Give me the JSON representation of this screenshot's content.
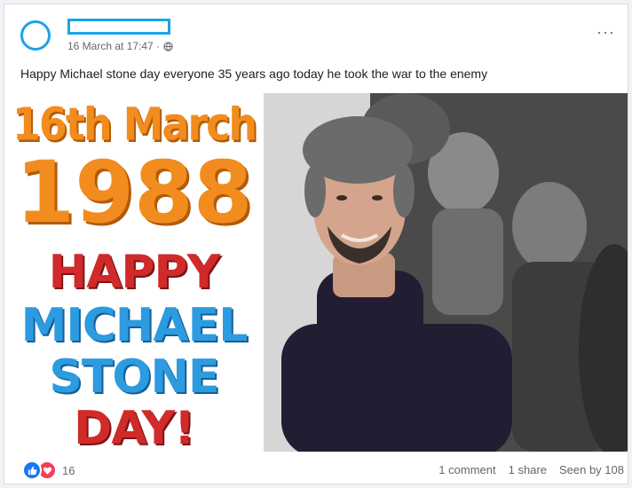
{
  "post": {
    "timestamp": "16 March at 17:47 ·",
    "privacy_icon": "globe-icon",
    "more_label": "···",
    "caption": "Happy Michael stone day everyone 35 years ago today he took the war to the enemy"
  },
  "image": {
    "line_date": "16th March",
    "line_year": "1988",
    "line_1": "HAPPY",
    "line_2": "MICHAEL",
    "line_3": "STONE",
    "line_4": "DAY!"
  },
  "footer": {
    "reaction_icons": [
      "like-icon",
      "love-icon"
    ],
    "reaction_count": "16",
    "comments": "1 comment",
    "shares": "1 share",
    "seen_by": "Seen by 108"
  },
  "colors": {
    "accent_redaction": "#1aa3e8",
    "banner_orange": "#f28c1e",
    "banner_red": "#d02a2a",
    "banner_blue": "#2d9be0",
    "like_blue": "#1877f2",
    "love_red": "#f33e58"
  }
}
